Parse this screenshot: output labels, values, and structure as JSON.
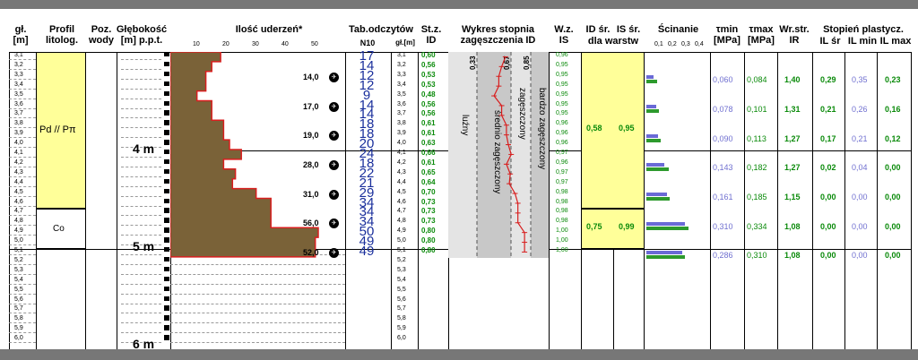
{
  "headers": {
    "gl": "gł.",
    "gl_unit": "[m]",
    "profil": "Profil",
    "litolog": "litolog.",
    "poz": "Poz.",
    "wody": "wody",
    "glebokosc": "Głębokość",
    "glebokosc2": "[m] p.p.t.",
    "ilosc": "Ilość uderzeń*",
    "tab": "Tab.odczytów",
    "n10": "N10",
    "glm": "gł.[m]",
    "stz": "St.z.",
    "id": "ID",
    "wykres1": "Wykres stopnia",
    "wykres2": "zagęszczenia ID",
    "wz": "W.z.",
    "is": "IS",
    "idsr": "ID śr.",
    "issr": "IS śr.",
    "dla": "dla warstw",
    "scin": "Ścinanie",
    "tmin": "τmin",
    "tmax": "τmax",
    "mpa1": "[MPa]",
    "mpa2": "[MPa]",
    "wrstr": "Wr.str.",
    "ir": "IR",
    "stopien": "Stopień plastycz.",
    "ilsr": "IL śr",
    "ilmin": "IL min",
    "ilmax": "IL max"
  },
  "scales": {
    "blows": [
      "10",
      "20",
      "30",
      "40",
      "50"
    ],
    "shear": [
      "0,1",
      "0,2",
      "0,3",
      "0,4"
    ]
  },
  "depths": [
    "3,1",
    "3,2",
    "3,3",
    "3,4",
    "3,5",
    "3,6",
    "3,7",
    "3,8",
    "3,9",
    "4,0",
    "4,1",
    "4,2",
    "4,3",
    "4,4",
    "4,5",
    "4,6",
    "4,7",
    "4,8",
    "4,9",
    "5,0",
    "5,1",
    "5,2",
    "5,3",
    "5,4",
    "5,5",
    "5,6",
    "5,7",
    "5,8",
    "5,9",
    "6,0"
  ],
  "big_marks": [
    "4 m",
    "5 m",
    "6 m"
  ],
  "layers": [
    {
      "name": "Pd // Pπ"
    },
    {
      "name": "Co"
    }
  ],
  "n10": [
    "17",
    "14",
    "12",
    "12",
    "9",
    "14",
    "14",
    "18",
    "18",
    "20",
    "24",
    "18",
    "22",
    "21",
    "29",
    "34",
    "34",
    "34",
    "50",
    "49",
    "49"
  ],
  "id_values": [
    "0,60",
    "0,56",
    "0,53",
    "0,53",
    "0,48",
    "0,56",
    "0,56",
    "0,61",
    "0,61",
    "0,63",
    "0,66",
    "0,61",
    "0,65",
    "0,64",
    "0,70",
    "0,73",
    "0,73",
    "0,73",
    "0,80",
    "0,80",
    "0,80"
  ],
  "is_values": [
    "0,96",
    "0,95",
    "0,95",
    "0,95",
    "0,95",
    "0,95",
    "0,95",
    "0,96",
    "0,96",
    "0,96",
    "0,97",
    "0,96",
    "0,97",
    "0,97",
    "0,98",
    "0,98",
    "0,98",
    "0,98",
    "1,00",
    "1,00",
    "1,00"
  ],
  "blows": [
    {
      "depth": "14,0"
    },
    {
      "depth": "17,0"
    },
    {
      "depth": "19,0"
    },
    {
      "depth": "28,0"
    },
    {
      "depth": "31,0"
    },
    {
      "depth": "56,0"
    },
    {
      "depth": "52,0"
    }
  ],
  "density_chart": {
    "labels": [
      "luźny",
      "średnio zagęszczony",
      "zagęszczony",
      "bardzo zagęszczony"
    ],
    "thresholds": [
      "0,33",
      "0,67",
      "0,85"
    ]
  },
  "layer_averages": [
    {
      "id": "0,58",
      "is": "0,95"
    },
    {
      "id": "0,75",
      "is": "0,99"
    }
  ],
  "shear_rows": [
    {
      "tmin": "0,060",
      "tmax": "0,084",
      "ir": "1,40",
      "ilsr": "0,29",
      "ilmin": "0,35",
      "ilmax": "0,23"
    },
    {
      "tmin": "0,078",
      "tmax": "0,101",
      "ir": "1,31",
      "ilsr": "0,21",
      "ilmin": "0,26",
      "ilmax": "0,16"
    },
    {
      "tmin": "0,090",
      "tmax": "0,113",
      "ir": "1,27",
      "ilsr": "0,17",
      "ilmin": "0,21",
      "ilmax": "0,12"
    },
    {
      "tmin": "0,143",
      "tmax": "0,182",
      "ir": "1,27",
      "ilsr": "0,02",
      "ilmin": "0,04",
      "ilmax": "0,00"
    },
    {
      "tmin": "0,161",
      "tmax": "0,185",
      "ir": "1,15",
      "ilsr": "0,00",
      "ilmin": "0,00",
      "ilmax": "0,00"
    },
    {
      "tmin": "0,310",
      "tmax": "0,334",
      "ir": "1,08",
      "ilsr": "0,00",
      "ilmin": "0,00",
      "ilmax": "0,00"
    },
    {
      "tmin": "0,286",
      "tmax": "0,310",
      "ir": "1,08",
      "ilsr": "0,00",
      "ilmin": "0,00",
      "ilmax": "0,00"
    }
  ],
  "shear_bars": [
    {
      "tmin": 0.06,
      "tmax": 0.084
    },
    {
      "tmin": 0.078,
      "tmax": 0.101
    },
    {
      "tmin": 0.09,
      "tmax": 0.113
    },
    {
      "tmin": 0.143,
      "tmax": 0.182
    },
    {
      "tmin": 0.161,
      "tmax": 0.185
    },
    {
      "tmin": 0.31,
      "tmax": 0.334
    },
    {
      "tmin": 0.286,
      "tmax": 0.31
    }
  ],
  "colors": {
    "soil_brown": "#7a6238",
    "profile_red": "#d81e1e",
    "yellow": "#ffff99",
    "green": "#0a8a0a",
    "blue": "#1a2f9c",
    "purple": "#7070d0"
  }
}
